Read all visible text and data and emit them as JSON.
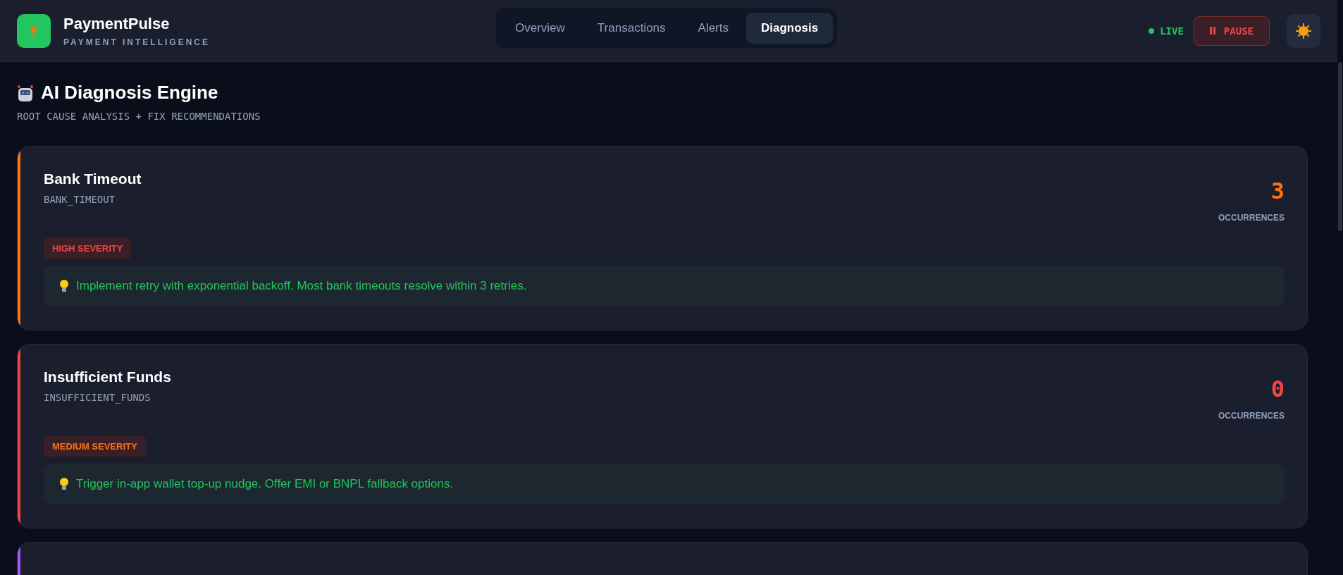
{
  "brand": {
    "name": "PaymentPulse",
    "tagline": "PAYMENT INTELLIGENCE"
  },
  "tabs": [
    {
      "label": "Overview",
      "selected": false
    },
    {
      "label": "Transactions",
      "selected": false
    },
    {
      "label": "Alerts",
      "selected": false
    },
    {
      "label": "Diagnosis",
      "selected": true
    }
  ],
  "status": {
    "label": "LIVE",
    "live": true
  },
  "pause_button": {
    "label": "PAUSE"
  },
  "page": {
    "title": "AI Diagnosis Engine",
    "subtitle": "ROOT CAUSE ANALYSIS + FIX RECOMMENDATIONS"
  },
  "diagnoses": [
    {
      "title": "Bank Timeout",
      "code": "BANK_TIMEOUT",
      "count": "3",
      "count_label": "OCCURRENCES",
      "kind": "high",
      "severity_label": "HIGH SEVERITY",
      "fix": "Implement retry with exponential backoff. Most bank timeouts resolve within 3 retries.",
      "color": "#f97316"
    },
    {
      "title": "Insufficient Funds",
      "code": "INSUFFICIENT_FUNDS",
      "count": "0",
      "count_label": "OCCURRENCES",
      "kind": "medium",
      "severity_label": "MEDIUM SEVERITY",
      "fix": "Trigger in-app wallet top-up nudge. Offer EMI or BNPL fallback options.",
      "color": "#ef4444"
    },
    {
      "color": "#a855f7"
    }
  ]
}
